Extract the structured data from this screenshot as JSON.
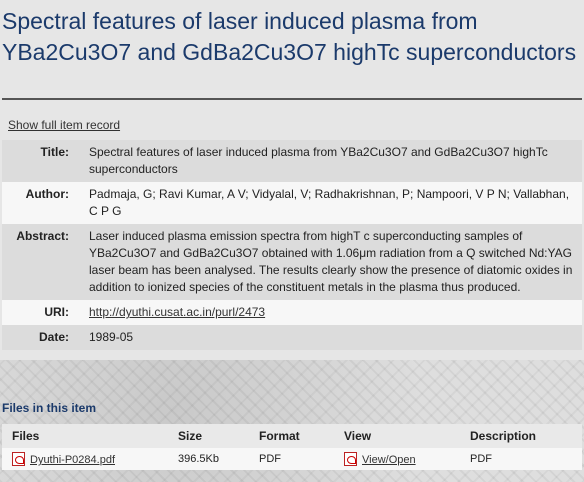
{
  "item": {
    "title": "Spectral features of laser induced plasma from YBa2Cu3O7 and GdBa2Cu3O7 highTc superconductors",
    "show_full_label": "Show full item record"
  },
  "metadata": [
    {
      "label": "Title:",
      "value": "Spectral features of laser induced plasma from YBa2Cu3O7 and GdBa2Cu3O7 highTc superconductors"
    },
    {
      "label": "Author:",
      "value": "Padmaja, G; Ravi Kumar, A V; Vidyalal, V; Radhakrishnan, P; Nampoori, V P N; Vallabhan, C P G"
    },
    {
      "label": "Abstract:",
      "value": "Laser induced plasma emission spectra from highT c superconducting samples of YBa2Cu3O7 and GdBa2Cu3O7 obtained with 1.06μm radiation from a Q switched Nd:YAG laser beam has been analysed. The results clearly show the presence of diatomic oxides in addition to ionized species of the constituent metals in the plasma thus produced."
    },
    {
      "label": "URI:",
      "value": "http://dyuthi.cusat.ac.in/purl/2473"
    },
    {
      "label": "Date:",
      "value": "1989-05"
    }
  ],
  "files": {
    "heading": "Files in this item",
    "columns": [
      "Files",
      "Size",
      "Format",
      "View",
      "Description"
    ],
    "rows": [
      {
        "name": "Dyuthi-P0284.pdf",
        "size": "396.5Kb",
        "format": "PDF",
        "view": "View/Open",
        "description": "PDF",
        "icon": "pdf-icon"
      }
    ]
  }
}
